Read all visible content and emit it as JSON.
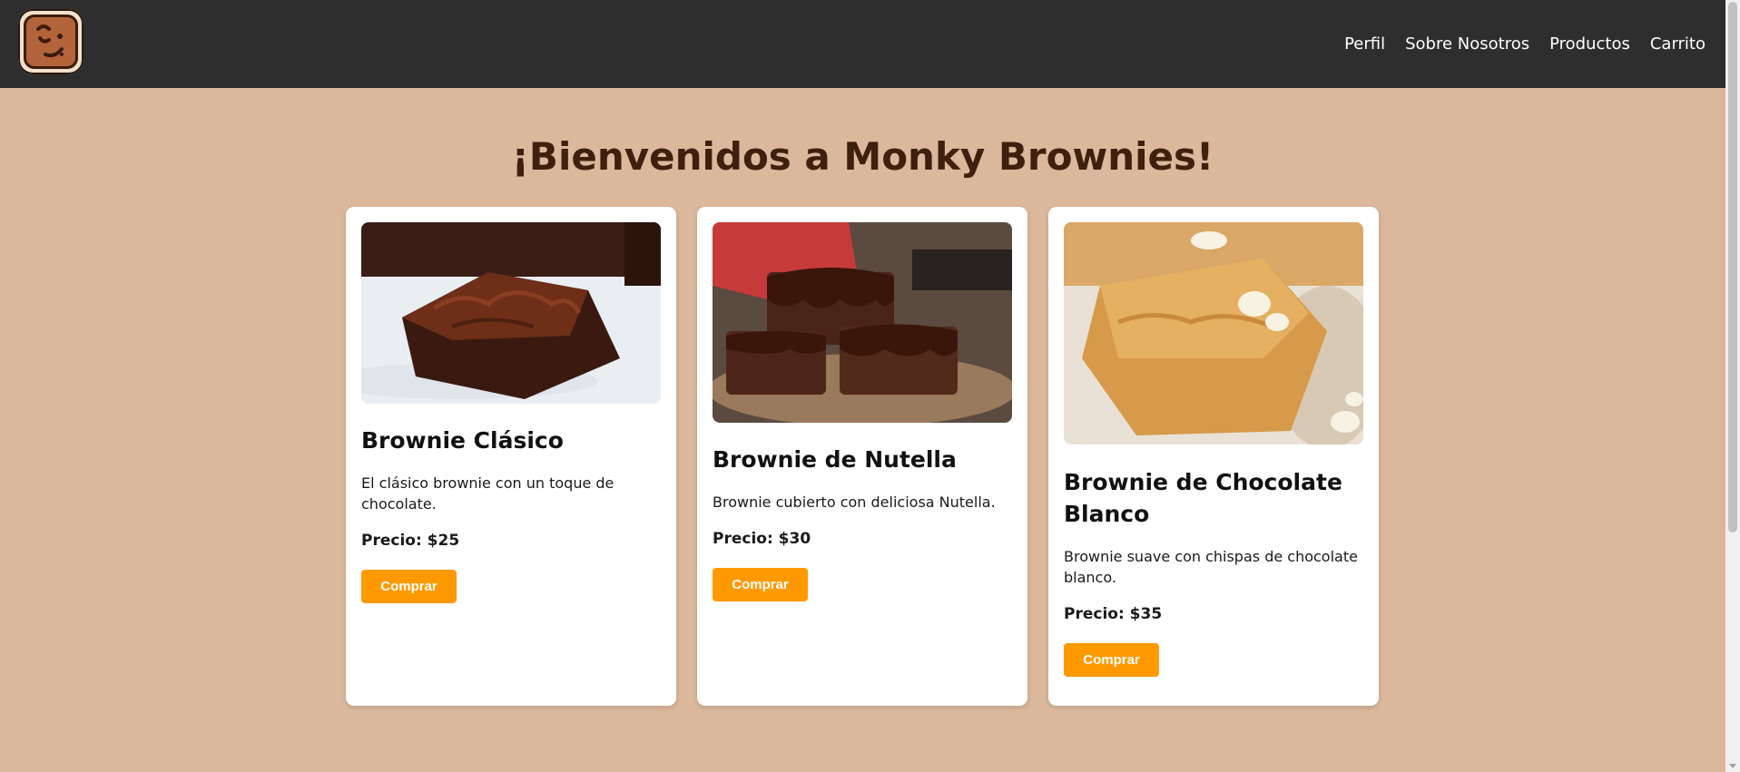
{
  "header": {
    "logo_icon": "brownie-face-logo-icon",
    "nav": [
      {
        "label": "Perfil"
      },
      {
        "label": "Sobre Nosotros"
      },
      {
        "label": "Productos"
      },
      {
        "label": "Carrito"
      }
    ]
  },
  "main": {
    "title": "¡Bienvenidos a Monky Brownies!",
    "products": [
      {
        "image_icon": "classic-brownie-photo",
        "name": "Brownie Clásico",
        "description": "El clásico brownie con un toque de chocolate.",
        "price": "Precio: $25",
        "button": "Comprar"
      },
      {
        "image_icon": "nutella-brownie-photo",
        "name": "Brownie de Nutella",
        "description": "Brownie cubierto con deliciosa Nutella.",
        "price": "Precio: $30",
        "button": "Comprar"
      },
      {
        "image_icon": "white-chocolate-brownie-photo",
        "name": "Brownie de Chocolate Blanco",
        "description": "Brownie suave con chispas de chocolate blanco.",
        "price": "Precio: $35",
        "button": "Comprar"
      }
    ]
  },
  "colors": {
    "header_bg": "#2e2e2e",
    "page_bg": "#dbb89c",
    "title": "#3f1f0d",
    "button": "#ff9900"
  }
}
